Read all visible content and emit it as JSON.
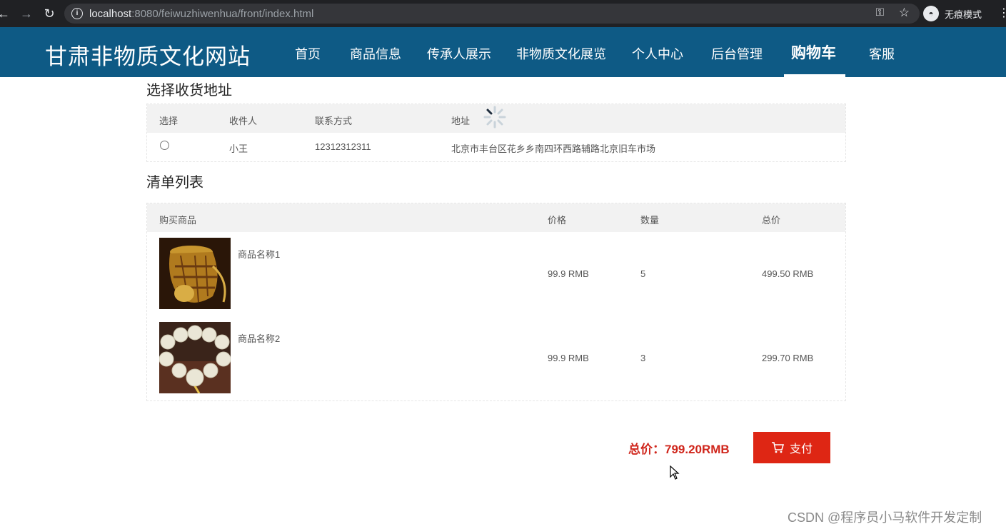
{
  "browser": {
    "url_host": "localhost",
    "url_path": ":8080/feiwuzhiwenhua/front/index.html",
    "incognito_label": "无痕模式"
  },
  "site": {
    "title": "甘肃非物质文化网站",
    "nav": [
      {
        "label": "首页"
      },
      {
        "label": "商品信息"
      },
      {
        "label": "传承人展示"
      },
      {
        "label": "非物质文化展览"
      },
      {
        "label": "个人中心"
      },
      {
        "label": "后台管理"
      },
      {
        "label": "购物车",
        "active": true
      },
      {
        "label": "客服"
      }
    ]
  },
  "address": {
    "section_title": "选择收货地址",
    "headers": [
      "选择",
      "收件人",
      "联系方式",
      "地址"
    ],
    "rows": [
      {
        "recipient": "小王",
        "phone": "12312312311",
        "address": "北京市丰台区花乡乡南四环西路辅路北京旧车市场"
      }
    ]
  },
  "cart": {
    "section_title": "清单列表",
    "headers": [
      "购买商品",
      "价格",
      "数量",
      "总价"
    ],
    "items": [
      {
        "name": "商品名称1",
        "price": "99.9 RMB",
        "qty": "5",
        "subtotal": "499.50 RMB"
      },
      {
        "name": "商品名称2",
        "price": "99.9 RMB",
        "qty": "3",
        "subtotal": "299.70 RMB"
      }
    ]
  },
  "checkout": {
    "total_label": "总价：799.20RMB",
    "pay_label": "支付"
  },
  "watermark": "CSDN @程序员小马软件开发定制",
  "colors": {
    "header_bg": "#0e5a85",
    "accent_red": "#de2614",
    "total_red": "#d0271d"
  }
}
